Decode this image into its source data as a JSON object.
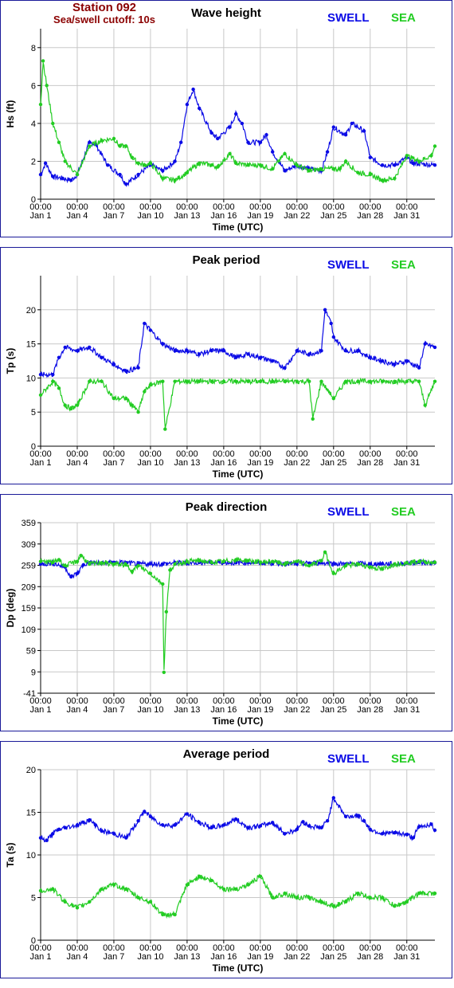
{
  "station": {
    "name": "Station 092",
    "cutoff": "Sea/swell cutoff: 10s"
  },
  "colors": {
    "swell": "#0a0ae6",
    "sea": "#22cc22",
    "grid": "#c8c8c8",
    "frame": "#1a1a99"
  },
  "x_ticks": [
    [
      "00:00",
      "Jan 1"
    ],
    [
      "00:00",
      "Jan 4"
    ],
    [
      "00:00",
      "Jan 7"
    ],
    [
      "00:00",
      "Jan 10"
    ],
    [
      "00:00",
      "Jan 13"
    ],
    [
      "00:00",
      "Jan 16"
    ],
    [
      "00:00",
      "Jan 19"
    ],
    [
      "00:00",
      "Jan 22"
    ],
    [
      "00:00",
      "Jan 25"
    ],
    [
      "00:00",
      "Jan 28"
    ],
    [
      "00:00",
      "Jan 31"
    ]
  ],
  "chart_data": [
    {
      "type": "line",
      "title": "Wave height",
      "xlabel": "Time (UTC)",
      "ylabel": "Hs (ft)",
      "ylim": [
        0,
        9
      ],
      "yticks": [
        "0",
        "2",
        "4",
        "6",
        "8"
      ],
      "xlim": [
        1,
        33.3
      ],
      "grid": true,
      "legend": [
        "SWELL",
        "SEA"
      ],
      "legend_position": "top-right",
      "series": [
        {
          "name": "SWELL",
          "x": [
            1,
            1.4,
            2,
            2.8,
            3.5,
            4,
            5,
            5.5,
            6.5,
            7.5,
            8,
            9,
            10,
            11,
            12,
            12.5,
            13,
            13.5,
            14,
            15,
            15.5,
            16.5,
            17,
            17.5,
            18,
            19,
            19.5,
            20,
            21,
            22,
            23,
            24,
            24.5,
            25,
            26,
            26.5,
            27.5,
            28,
            29,
            30,
            31,
            31.5,
            33.3
          ],
          "y": [
            1.3,
            1.9,
            1.2,
            1.1,
            1.0,
            1.3,
            3.0,
            2.9,
            1.8,
            1.3,
            0.8,
            1.3,
            1.8,
            1.5,
            2.0,
            3.0,
            5.0,
            5.8,
            4.8,
            3.5,
            3.2,
            3.8,
            4.5,
            4.0,
            3.0,
            3.0,
            3.4,
            2.5,
            1.5,
            1.8,
            1.6,
            1.5,
            2.5,
            3.8,
            3.4,
            4.0,
            3.6,
            2.2,
            1.8,
            1.8,
            2.2,
            1.9,
            1.8
          ]
        },
        {
          "name": "SEA",
          "x": [
            1,
            1.2,
            1.5,
            2,
            2.5,
            3,
            4,
            5,
            6,
            7,
            7.5,
            8,
            8.5,
            9,
            9.5,
            10,
            11,
            12,
            13,
            14,
            15,
            15.5,
            16.5,
            17,
            18,
            19,
            20,
            21,
            22,
            23,
            24,
            25,
            25.5,
            26,
            27,
            28,
            29,
            30,
            31,
            32,
            33,
            33.3
          ],
          "y": [
            5.0,
            7.3,
            6.0,
            4.0,
            3.0,
            2.0,
            1.3,
            2.8,
            3.1,
            3.2,
            2.8,
            2.8,
            2.2,
            1.9,
            1.8,
            1.9,
            1.1,
            1.0,
            1.4,
            1.9,
            1.8,
            1.7,
            2.4,
            1.9,
            1.8,
            1.8,
            1.6,
            2.4,
            1.8,
            1.5,
            1.6,
            1.6,
            1.6,
            2.0,
            1.4,
            1.3,
            1.0,
            1.1,
            2.3,
            2.0,
            2.3,
            2.8
          ]
        }
      ]
    },
    {
      "type": "line",
      "title": "Peak period",
      "xlabel": "Time (UTC)",
      "ylabel": "Tp (s)",
      "ylim": [
        0,
        25
      ],
      "yticks": [
        "0",
        "5",
        "10",
        "15",
        "20"
      ],
      "xlim": [
        1,
        33.3
      ],
      "grid": true,
      "legend": [
        "SWELL",
        "SEA"
      ],
      "legend_position": "top-right",
      "series": [
        {
          "name": "SWELL",
          "x": [
            1,
            2,
            2.5,
            3,
            4,
            5,
            6,
            7,
            8,
            9,
            9.5,
            10,
            11,
            12,
            13,
            14,
            15,
            16,
            17,
            18,
            19,
            20,
            21,
            22,
            23,
            24,
            24.3,
            24.8,
            25,
            26,
            27,
            28,
            29,
            30,
            31,
            32,
            32.5,
            33.3
          ],
          "y": [
            10.5,
            10.5,
            13,
            14.5,
            14,
            14.5,
            13,
            12,
            11,
            11.5,
            18,
            17,
            15,
            14,
            14,
            13.5,
            14,
            14,
            13,
            13.5,
            13,
            12.5,
            11.5,
            14,
            13.5,
            14,
            20,
            18,
            16,
            14,
            14,
            13,
            12.5,
            12,
            12.5,
            11.5,
            15,
            14.5
          ]
        },
        {
          "name": "SEA",
          "x": [
            1,
            2,
            2.5,
            3,
            3.5,
            4,
            5,
            6,
            7,
            8,
            8.5,
            9,
            9.5,
            10,
            11,
            11.2,
            12,
            13,
            14,
            15,
            16,
            17,
            18,
            19,
            20,
            21,
            22,
            23,
            23.3,
            24,
            25,
            26,
            27,
            28,
            29,
            30,
            31,
            32,
            32.5,
            33.3
          ],
          "y": [
            7.5,
            9.5,
            8.5,
            6,
            5.5,
            6,
            9.5,
            9.5,
            7,
            7,
            6,
            5,
            8,
            9,
            9.5,
            2.5,
            9.5,
            9.5,
            9.5,
            9.5,
            9.5,
            9.5,
            9.5,
            9.5,
            9.5,
            9.5,
            9.5,
            9.5,
            4,
            9.5,
            7,
            9.5,
            9.5,
            9.5,
            9.5,
            9.5,
            9.5,
            9.5,
            6,
            9.5
          ]
        }
      ]
    },
    {
      "type": "line",
      "title": "Peak direction",
      "xlabel": "Time (UTC)",
      "ylabel": "Dp (deg)",
      "ylim": [
        -41,
        359
      ],
      "yticks": [
        "-41",
        "9",
        "59",
        "109",
        "159",
        "209",
        "259",
        "309",
        "359"
      ],
      "xlim": [
        1,
        33.3
      ],
      "grid": true,
      "legend": [
        "SWELL",
        "SEA"
      ],
      "legend_position": "top-right",
      "series": [
        {
          "name": "SWELL",
          "x": [
            1,
            2,
            3,
            3.5,
            4,
            4.5,
            5,
            6,
            7,
            8,
            9,
            10,
            11,
            12,
            13,
            14,
            15,
            16,
            17,
            18,
            19,
            20,
            21,
            22,
            23,
            24,
            25,
            26,
            27,
            28,
            29,
            30,
            31,
            32,
            33.3
          ],
          "y": [
            262,
            264,
            255,
            232,
            240,
            260,
            265,
            264,
            266,
            265,
            262,
            263,
            262,
            265,
            264,
            266,
            265,
            266,
            265,
            266,
            265,
            264,
            263,
            262,
            264,
            265,
            263,
            262,
            263,
            262,
            263,
            262,
            264,
            266,
            265
          ]
        },
        {
          "name": "SEA",
          "x": [
            1,
            2,
            2.5,
            3,
            4,
            4.3,
            5,
            6,
            7,
            8,
            8.5,
            9,
            10,
            11,
            11.1,
            11.3,
            11.6,
            12,
            13,
            14,
            15,
            16,
            17,
            18,
            19,
            20,
            21,
            22,
            23,
            24,
            24.3,
            25,
            26,
            27,
            28,
            29,
            30,
            31,
            32,
            33.3
          ],
          "y": [
            268,
            266,
            272,
            258,
            268,
            282,
            262,
            265,
            262,
            260,
            245,
            258,
            240,
            215,
            8,
            150,
            248,
            262,
            268,
            270,
            266,
            268,
            272,
            270,
            266,
            268,
            262,
            268,
            258,
            270,
            290,
            240,
            258,
            262,
            255,
            250,
            262,
            265,
            268,
            266
          ]
        }
      ]
    },
    {
      "type": "line",
      "title": "Average period",
      "xlabel": "Time (UTC)",
      "ylabel": "Ta (s)",
      "ylim": [
        0,
        20
      ],
      "yticks": [
        "0",
        "5",
        "10",
        "15",
        "20"
      ],
      "xlim": [
        1,
        33.3
      ],
      "grid": true,
      "legend": [
        "SWELL",
        "SEA"
      ],
      "legend_position": "top-right",
      "series": [
        {
          "name": "SWELL",
          "x": [
            1,
            1.5,
            2,
            2.5,
            3,
            4,
            5,
            5.5,
            6,
            7,
            8,
            9,
            9.5,
            10,
            11,
            12,
            13,
            14,
            15,
            16,
            17,
            18,
            19,
            20,
            21,
            22,
            22.5,
            23,
            24,
            24.5,
            25,
            26,
            27,
            27.5,
            28,
            29,
            30,
            31,
            31.5,
            32,
            33,
            33.3
          ],
          "y": [
            12,
            11.7,
            12.5,
            13,
            13.2,
            13.5,
            14.1,
            13.5,
            12.8,
            12.5,
            12,
            14,
            15.1,
            14.5,
            13.5,
            13.5,
            14.8,
            13.8,
            13.2,
            13.5,
            14.2,
            13.2,
            13.4,
            13.8,
            12.5,
            13.0,
            13.9,
            13.4,
            13.2,
            14.0,
            16.7,
            14.5,
            14.6,
            14.0,
            13.0,
            12.5,
            12.6,
            12.4,
            12.0,
            13.3,
            13.6,
            12.9
          ]
        },
        {
          "name": "SEA",
          "x": [
            1,
            2,
            3,
            4,
            5,
            6,
            7,
            8,
            9,
            10,
            11,
            12,
            13,
            14,
            15,
            16,
            17,
            18,
            19,
            20,
            21,
            22,
            23,
            24,
            25,
            26,
            27,
            28,
            29,
            30,
            31,
            32,
            33.3
          ],
          "y": [
            5.8,
            6,
            4.5,
            3.8,
            4.5,
            6,
            6.5,
            6,
            5,
            4.5,
            3,
            3,
            6.5,
            7.5,
            7,
            6,
            6,
            6.5,
            7.5,
            5,
            5.5,
            5,
            5,
            4.5,
            4,
            4.5,
            5.5,
            5,
            5,
            4,
            4.5,
            5.5,
            5.5
          ]
        }
      ]
    }
  ]
}
